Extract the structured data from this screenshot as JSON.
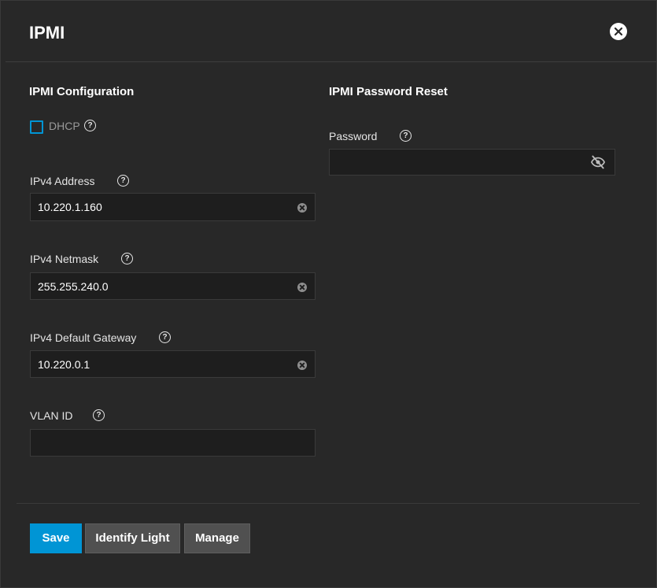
{
  "dialog": {
    "title": "IPMI",
    "close_icon": "close-icon"
  },
  "config": {
    "heading": "IPMI Configuration",
    "dhcp": {
      "label": "DHCP",
      "checked": false
    },
    "ipv4_address": {
      "label": "IPv4 Address",
      "value": "10.220.1.160"
    },
    "ipv4_netmask": {
      "label": "IPv4 Netmask",
      "value": "255.255.240.0"
    },
    "ipv4_gateway": {
      "label": "IPv4 Default Gateway",
      "value": "10.220.0.1"
    },
    "vlan_id": {
      "label": "VLAN ID",
      "value": ""
    }
  },
  "password_reset": {
    "heading": "IPMI Password Reset",
    "password": {
      "label": "Password",
      "value": ""
    },
    "visibility_icon": "eye-off-icon"
  },
  "help_glyph": "?",
  "buttons": {
    "save": "Save",
    "identify_light": "Identify Light",
    "manage": "Manage"
  },
  "colors": {
    "background": "#282828",
    "accent": "#0095d5",
    "field_bg": "#1e1e1e",
    "button_grey": "#505050"
  }
}
